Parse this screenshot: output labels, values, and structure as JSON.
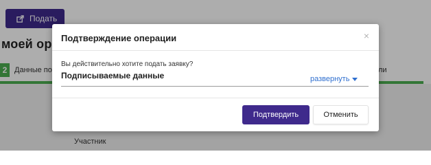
{
  "background": {
    "submit_button_label": "Подать",
    "page_title": "моей орг",
    "step_number": "2",
    "step_label": "Данные по",
    "step_right_label": "ли",
    "participant_label": "Участник"
  },
  "modal": {
    "title": "Подтверждение операции",
    "close_symbol": "×",
    "question": "Вы действительно хотите подать заявку?",
    "field_label": "Подписываемые данные",
    "expand_label": "развернуть",
    "confirm_label": "Подтвердить",
    "cancel_label": "Отменить"
  },
  "colors": {
    "primary": "#3f2a8c",
    "success": "#4caf50",
    "link": "#2f6fcf"
  },
  "icons": {
    "submit_icon": "share-icon",
    "expand_icon": "triangle-down-icon"
  }
}
